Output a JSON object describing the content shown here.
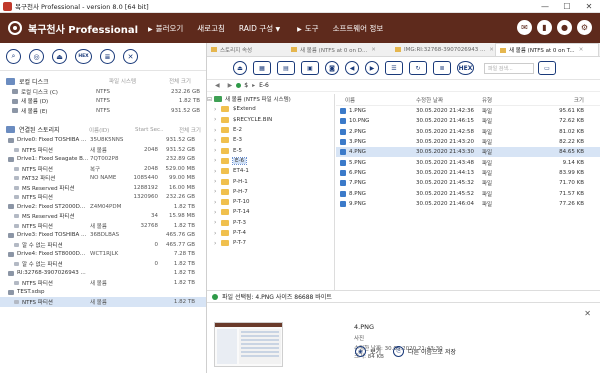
{
  "window": {
    "title": "복구천사 Professional - version 8.0 [64 bit]",
    "min": "—",
    "max": "☐",
    "close": "✕"
  },
  "header": {
    "brand": "복구천사 Professional",
    "menu": [
      "불러오기",
      "새로고침",
      "RAID 구성",
      "도구",
      "소프트웨어 정보"
    ],
    "icons": [
      "mail-icon",
      "book-icon",
      "user-icon",
      "gear-icon"
    ]
  },
  "left": {
    "toolbar": [
      "search-icon",
      "scan-icon",
      "eject-icon",
      "hex-icon",
      "list-icon",
      "close-icon"
    ],
    "hex_label": "HEX",
    "local": {
      "title": "로컬 디스크",
      "col2": "파일 시스템",
      "col3": "전체 크기",
      "rows": [
        {
          "name": "로컬 디스크 (C)",
          "fs": "NTFS",
          "size": "232.26 GB"
        },
        {
          "name": "새 볼륨 (D)",
          "fs": "NTFS",
          "size": "1.82 TB"
        },
        {
          "name": "새 볼륨 (E)",
          "fs": "NTFS",
          "size": "931.52 GB"
        }
      ]
    },
    "connected": {
      "title": "연결된 스토리지",
      "col2": "이름(ID)",
      "col3": "Start Sec..",
      "col4": "전체 크기",
      "rows": [
        {
          "type": "disk",
          "name": "Drive0: Fixed TOSHIBA ...",
          "id": "35U8K5NNS",
          "start": "",
          "size": "931.52 GB"
        },
        {
          "type": "part",
          "name": "NTFS 파티션",
          "id": "새 볼륨",
          "start": "2048",
          "size": "931.52 GB"
        },
        {
          "type": "disk",
          "name": "Drive1: Fixed Seagate B...",
          "id": "7QT002P8",
          "start": "",
          "size": "232.89 GB"
        },
        {
          "type": "part",
          "name": "NTFS 파티션",
          "id": "복구",
          "start": "2048",
          "size": "529.00 MB"
        },
        {
          "type": "part",
          "name": "FAT32 파티션",
          "id": "NO NAME",
          "start": "1085440",
          "size": "99.00 MB"
        },
        {
          "type": "part",
          "name": "MS Reserved 파티션",
          "id": "",
          "start": "1288192",
          "size": "16.00 MB"
        },
        {
          "type": "part",
          "name": "NTFS 파티션",
          "id": "",
          "start": "1320960",
          "size": "232.26 GB"
        },
        {
          "type": "disk",
          "name": "Drive2: Fixed ST2000D...",
          "id": "Z4M04PDM",
          "start": "",
          "size": "1.82 TB"
        },
        {
          "type": "part",
          "name": "MS Reserved 파티션",
          "id": "",
          "start": "34",
          "size": "15.98 MB"
        },
        {
          "type": "part",
          "name": "NTFS 파티션",
          "id": "새 볼륨",
          "start": "32768",
          "size": "1.82 TB"
        },
        {
          "type": "disk",
          "name": "Drive3: Fixed TOSHIBA ...",
          "id": "36BDLBAS",
          "start": "",
          "size": "465.76 GB"
        },
        {
          "type": "part",
          "name": "알 수 없는 파티션",
          "id": "",
          "start": "0",
          "size": "465.77 GB"
        },
        {
          "type": "disk",
          "name": "Drive4: Fixed ST8000D...",
          "id": "WCT1RJLK",
          "start": "",
          "size": "7.28 TB"
        },
        {
          "type": "part",
          "name": "알 수 없는 파티션",
          "id": "",
          "start": "0",
          "size": "1.82 TB"
        },
        {
          "type": "disk",
          "name": "RI:32768-3907026943 ...",
          "id": "",
          "start": "",
          "size": "1.82 TB"
        },
        {
          "type": "part",
          "name": "NTFS 파티션",
          "id": "새 볼륨",
          "start": "",
          "size": "1.82 TB"
        },
        {
          "type": "disk",
          "name": "TEST.sdsp",
          "id": "",
          "start": "",
          "size": ""
        },
        {
          "type": "part",
          "name": "NTFS 파티션",
          "id": "새 볼륨",
          "start": "",
          "size": "1.82 TB",
          "selected": true
        }
      ]
    }
  },
  "tabs": [
    {
      "label": "스토리지 속성",
      "active": false
    },
    {
      "label": "새 볼륨 (NTFS at 0 on D...",
      "active": false
    },
    {
      "label": "IMG:RI:32768-3907026943 ...",
      "active": false
    },
    {
      "label": "새 볼륨 (NTFS at 0 on T...",
      "active": true
    }
  ],
  "rtoolbar": {
    "hex_label": "HEX",
    "search_placeholder": "파일 검색..."
  },
  "path": {
    "root": "$",
    "current": "E-6"
  },
  "tree": {
    "root_label": "새 볼륨 (NTFS 파일 시스템)",
    "nodes": [
      "$Extend",
      "$RECYCLE.BIN",
      "E-2",
      "E-3",
      "E-5",
      "E-6",
      "ET4-1",
      "P-H-1",
      "P-H-7",
      "P-T-10",
      "P-T-14",
      "P-T-3",
      "P-T-4",
      "P-T-7"
    ],
    "selected": "E-6"
  },
  "files": {
    "headers": [
      "이름",
      "수정한 날짜",
      "유형",
      "크기"
    ],
    "rows": [
      {
        "name": "1.PNG",
        "date": "30.05.2020 21:42:36",
        "type": "파일",
        "size": "95.61 KB"
      },
      {
        "name": "10.PNG",
        "date": "30.05.2020 21:46:15",
        "type": "파일",
        "size": "72.62 KB"
      },
      {
        "name": "2.PNG",
        "date": "30.05.2020 21:42:58",
        "type": "파일",
        "size": "81.02 KB"
      },
      {
        "name": "3.PNG",
        "date": "30.05.2020 21:43:20",
        "type": "파일",
        "size": "82.22 KB"
      },
      {
        "name": "4.PNG",
        "date": "30.05.2020 21:43:30",
        "type": "파일",
        "size": "84.65 KB",
        "selected": true
      },
      {
        "name": "5.PNG",
        "date": "30.05.2020 21:43:48",
        "type": "파일",
        "size": "9.14 KB"
      },
      {
        "name": "6.PNG",
        "date": "30.05.2020 21:44:13",
        "type": "파일",
        "size": "83.99 KB"
      },
      {
        "name": "7.PNG",
        "date": "30.05.2020 21:45:32",
        "type": "파일",
        "size": "71.70 KB"
      },
      {
        "name": "8.PNG",
        "date": "30.05.2020 21:45:52",
        "type": "파일",
        "size": "71.57 KB"
      },
      {
        "name": "9.PNG",
        "date": "30.05.2020 21:46:04",
        "type": "파일",
        "size": "77.26 KB"
      }
    ]
  },
  "status": {
    "text": "파일 선택됨: 4.PNG 사이즈 86688 바이트"
  },
  "preview": {
    "name": "4.PNG",
    "type": "사진",
    "modified": "수정한 날짜: 30.05.2020 21:43:30",
    "size": "크기: 84 KB",
    "view_label": "보기",
    "save_label": "다른 이름으로 저장"
  }
}
